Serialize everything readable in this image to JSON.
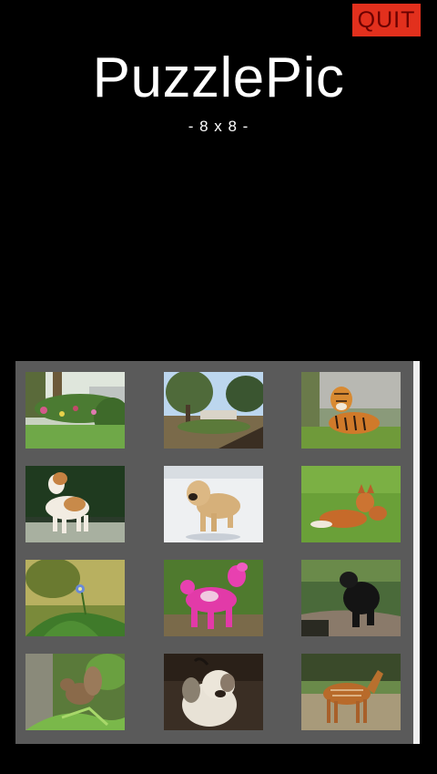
{
  "header": {
    "quit_label": "QUIT",
    "app_title": "PuzzlePic",
    "grid_size_label": "- 8 x 8 -"
  },
  "gallery": {
    "images": [
      {
        "name": "garden"
      },
      {
        "name": "trees-path"
      },
      {
        "name": "tiger"
      },
      {
        "name": "beagle"
      },
      {
        "name": "puppy-snow"
      },
      {
        "name": "fox"
      },
      {
        "name": "flower"
      },
      {
        "name": "pink-poodle"
      },
      {
        "name": "black-bear"
      },
      {
        "name": "squirrel"
      },
      {
        "name": "bulldog"
      },
      {
        "name": "horse"
      }
    ]
  },
  "colors": {
    "quit_bg": "#e2301d",
    "panel_bg": "#5a5a5a",
    "scrollbar": "#efefef"
  }
}
